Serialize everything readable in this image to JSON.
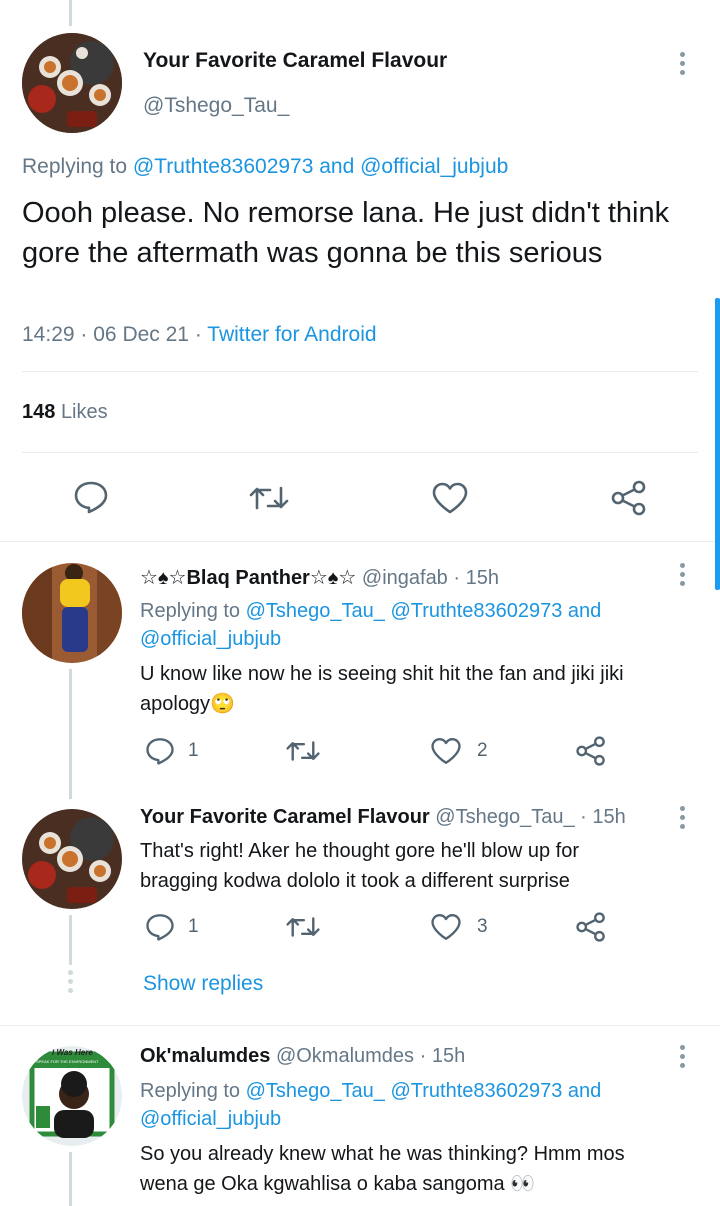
{
  "main_tweet": {
    "author_name": "Your Favorite Caramel Flavour",
    "handle": "@Tshego_Tau_",
    "replying_prefix": "Replying to",
    "replying_to": "@Truthte83602973 and @official_jubjub",
    "text": "Oooh please. No remorse lana. He just didn't think gore the aftermath was gonna be this serious",
    "time": "14:29",
    "date": "06 Dec 21",
    "source": "Twitter for Android",
    "likes_count": "148",
    "likes_label": "Likes"
  },
  "replies": [
    {
      "author_name": "☆♠☆Blaq Panther☆♠☆",
      "handle": "@ingafab",
      "age": "15h",
      "replying_prefix": "Replying to",
      "replying_to_1": "@Tshego_Tau_ @Truthte83602973 and",
      "replying_to_2": "@official_jubjub",
      "text_1": "U know like now he is seeing shit hit the fan and jiki jiki",
      "text_2": "apology🙄",
      "reply_count": "1",
      "like_count": "2"
    },
    {
      "author_name": "Your Favorite Caramel Flavour",
      "handle": "@Tshego_Tau_",
      "age": "15h",
      "text_1": "That's right! Aker he thought gore he'll blow up for",
      "text_2": "bragging kodwa dololo it took a different surprise",
      "reply_count": "1",
      "like_count": "3"
    },
    {
      "author_name": "Ok'malumdes",
      "handle": "@Okmalumdes",
      "age": "15h",
      "replying_prefix": "Replying to",
      "replying_to_1": "@Tshego_Tau_ @Truthte83602973 and",
      "replying_to_2": "@official_jubjub",
      "text_1": "So you already knew what he was thinking? Hmm mos",
      "text_2": "wena ge Oka kgwahlisa o kaba sangoma 👀",
      "avatar_text_1": "I Was Here",
      "avatar_text_2": "SPEAK FOR THE ENVIRONMENT"
    }
  ],
  "show_replies_label": "Show replies",
  "separator_dot": "·",
  "colors": {
    "accent": "#1b95e0",
    "text": "#14171a",
    "secondary": "#657786"
  }
}
